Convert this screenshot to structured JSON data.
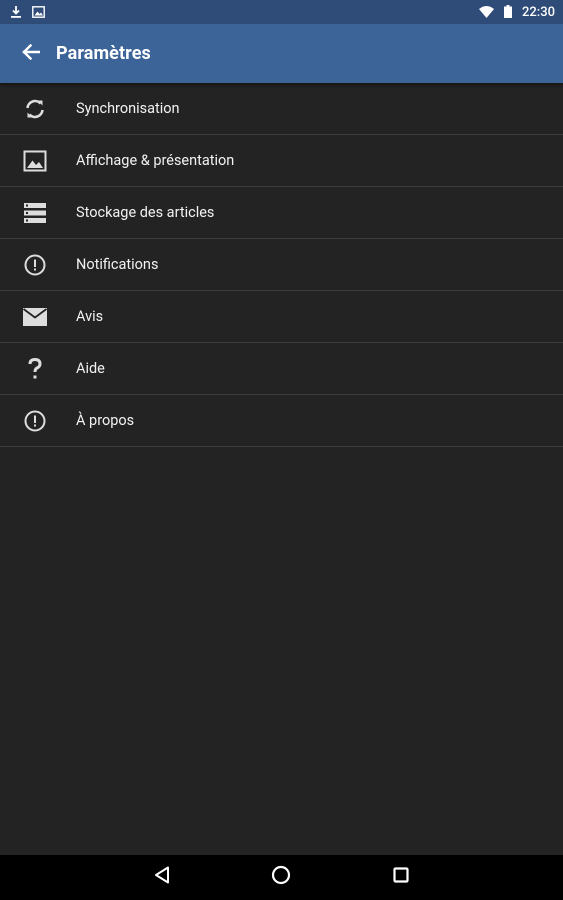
{
  "status_bar": {
    "time": "22:30",
    "icons": [
      "download-icon",
      "image-icon",
      "wifi-icon",
      "battery-icon"
    ]
  },
  "app_bar": {
    "title": "Paramètres",
    "back_icon": "arrow-back-icon",
    "color": "#3d6499"
  },
  "settings": {
    "items": [
      {
        "label": "Synchronisation",
        "icon": "sync-icon"
      },
      {
        "label": "Affichage & présentation",
        "icon": "image-icon"
      },
      {
        "label": "Stockage des articles",
        "icon": "storage-icon"
      },
      {
        "label": "Notifications",
        "icon": "info-circle-icon"
      },
      {
        "label": "Avis",
        "icon": "mail-icon"
      },
      {
        "label": "Aide",
        "icon": "question-icon"
      },
      {
        "label": "À propos",
        "icon": "info-circle-icon"
      }
    ]
  },
  "nav_bar": {
    "buttons": [
      "nav-back-icon",
      "nav-home-icon",
      "nav-recent-icon"
    ]
  },
  "colors": {
    "background": "#232323",
    "status_bar": "#2f4c79",
    "divider": "#3a3a3a"
  }
}
